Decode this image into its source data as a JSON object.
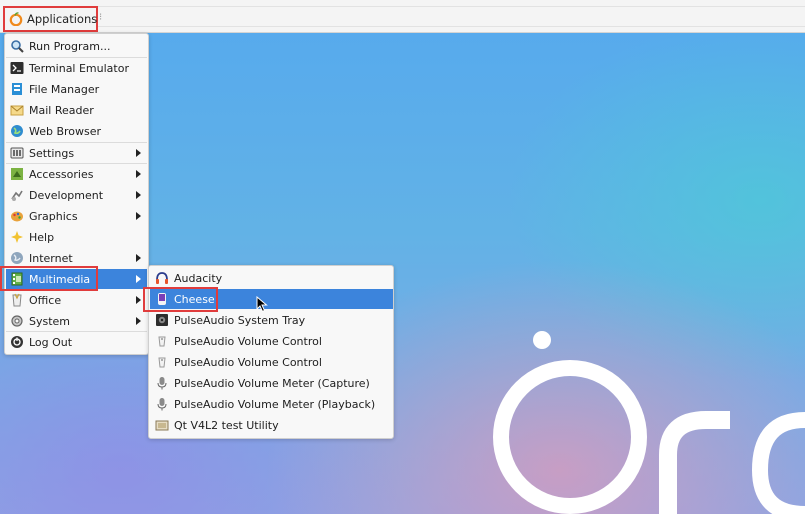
{
  "panel": {
    "applications_label": "Applications"
  },
  "main_menu": {
    "items": [
      {
        "label": "Run Program...",
        "icon": "magnifier-icon"
      },
      {
        "label": "Terminal Emulator",
        "icon": "terminal-icon"
      },
      {
        "label": "File Manager",
        "icon": "file-manager-icon"
      },
      {
        "label": "Mail Reader",
        "icon": "mail-icon"
      },
      {
        "label": "Web Browser",
        "icon": "globe-icon"
      },
      {
        "label": "Settings",
        "icon": "settings-icon",
        "submenu": true
      },
      {
        "label": "Accessories",
        "icon": "accessories-icon",
        "submenu": true
      },
      {
        "label": "Development",
        "icon": "development-icon",
        "submenu": true
      },
      {
        "label": "Graphics",
        "icon": "graphics-icon",
        "submenu": true
      },
      {
        "label": "Help",
        "icon": "help-icon"
      },
      {
        "label": "Internet",
        "icon": "internet-icon",
        "submenu": true
      },
      {
        "label": "Multimedia",
        "icon": "multimedia-icon",
        "submenu": true,
        "highlighted": true
      },
      {
        "label": "Office",
        "icon": "office-icon",
        "submenu": true
      },
      {
        "label": "System",
        "icon": "system-icon",
        "submenu": true
      },
      {
        "label": "Log Out",
        "icon": "logout-icon"
      }
    ]
  },
  "multimedia_menu": {
    "items": [
      {
        "label": "Audacity",
        "icon": "headphones-icon"
      },
      {
        "label": "Cheese",
        "icon": "cheese-icon",
        "selected": true
      },
      {
        "label": "PulseAudio System Tray",
        "icon": "speaker-icon"
      },
      {
        "label": "PulseAudio Volume Control",
        "icon": "volume-icon"
      },
      {
        "label": "PulseAudio Volume Control",
        "icon": "volume-icon"
      },
      {
        "label": "PulseAudio Volume Meter (Capture)",
        "icon": "microphone-icon"
      },
      {
        "label": "PulseAudio Volume Meter (Playback)",
        "icon": "microphone-icon"
      },
      {
        "label": "Qt V4L2 test Utility",
        "icon": "camera-app-icon"
      }
    ]
  },
  "colors": {
    "highlight": "#3c84dc",
    "annotation": "#e03c3c"
  }
}
